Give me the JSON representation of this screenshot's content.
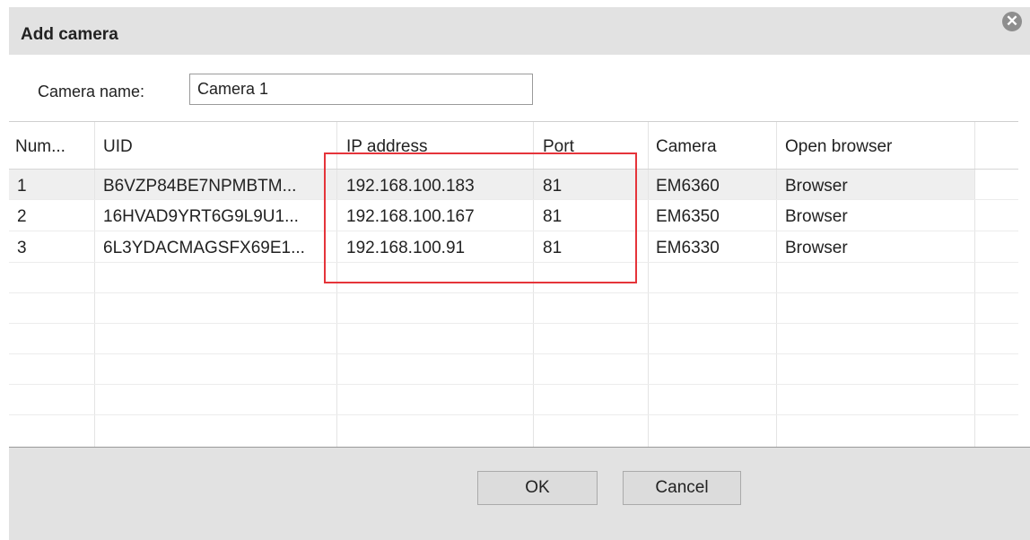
{
  "dialog": {
    "title": "Add camera",
    "close_icon": "close-icon"
  },
  "form": {
    "camera_name_label": "Camera name:",
    "camera_name_value": "Camera 1"
  },
  "table": {
    "columns": [
      "Num...",
      "UID",
      "IP address",
      "Port",
      "Camera",
      "Open browser"
    ],
    "rows": [
      {
        "num": "1",
        "uid": "B6VZP84BE7NPMBTM...",
        "ip": "192.168.100.183",
        "port": "81",
        "camera": "EM6360",
        "browser": "Browser"
      },
      {
        "num": "2",
        "uid": "16HVAD9YRT6G9L9U1...",
        "ip": "192.168.100.167",
        "port": "81",
        "camera": "EM6350",
        "browser": "Browser"
      },
      {
        "num": "3",
        "uid": "6L3YDACMAGSFX69E1...",
        "ip": "192.168.100.91",
        "port": "81",
        "camera": "EM6330",
        "browser": "Browser"
      }
    ],
    "selected_row": 1
  },
  "footer": {
    "ok_label": "OK",
    "cancel_label": "Cancel"
  },
  "colors": {
    "titlebar": "#e2e2e2",
    "highlight_box": "#e5343a",
    "selected_row": "#efefef"
  }
}
